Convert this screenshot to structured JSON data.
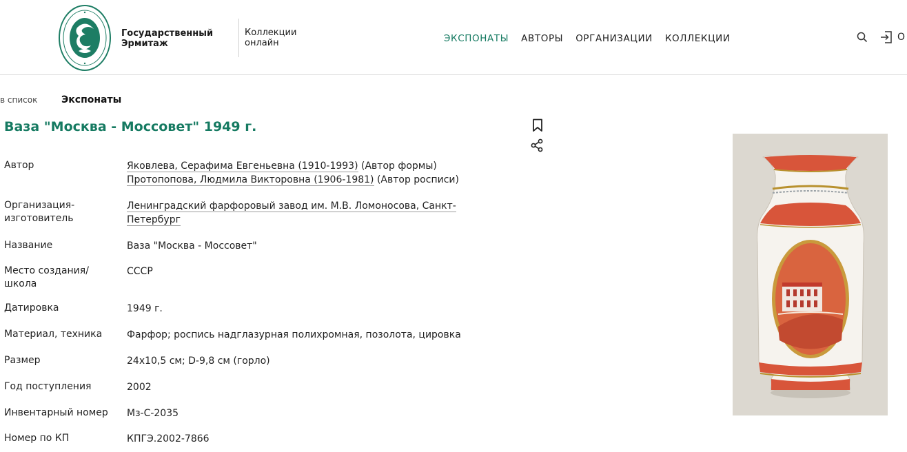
{
  "header": {
    "brand": "Государственный Эрмитаж",
    "section": "Коллекции онлайн",
    "nav": [
      "ЭКСПОНАТЫ",
      "АВТОРЫ",
      "ОРГАНИЗАЦИИ",
      "КОЛЛЕКЦИИ"
    ],
    "active_nav_index": 0,
    "trailing_text": "О",
    "icons": [
      "search-icon",
      "login-icon"
    ]
  },
  "breadcrumb": {
    "back": "в список",
    "current": "Экспонаты"
  },
  "item": {
    "title": "Ваза \"Москва - Моссовет\" 1949 г.",
    "image_alt": "Ваза \"Москва - Моссовет\"",
    "actions": [
      "bookmark-icon",
      "share-icon"
    ]
  },
  "details": {
    "author": {
      "label": "Автор",
      "entries": [
        {
          "name": "Яковлева, Серафима Евгеньевна (1910-1993)",
          "role": " (Автор формы)"
        },
        {
          "name": "Протопопова, Людмила Викторовна (1906-1981)",
          "role": " (Автор росписи)"
        }
      ]
    },
    "organization": {
      "label": "Организация-изготовитель",
      "value": "Ленинградский фарфоровый завод им. М.В. Ломоносова, Санкт-Петербург"
    },
    "name": {
      "label": "Название",
      "value": "Ваза \"Москва - Моссовет\""
    },
    "place": {
      "label": "Место создания/ школа",
      "value": "СССР"
    },
    "date": {
      "label": "Датировка",
      "value": "1949 г."
    },
    "material": {
      "label": "Материал, техника",
      "value": "Фарфор; роспись надглазурная полихромная, позолота, цировка"
    },
    "size": {
      "label": "Размер",
      "value": "24х10,5 см; D-9,8 см (горло)"
    },
    "acquired": {
      "label": "Год поступления",
      "value": "2002"
    },
    "inventory": {
      "label": "Инвентарный номер",
      "value": "Мз-С-2035"
    },
    "kp": {
      "label": "Номер по КП",
      "value": "КПГЭ.2002-7866"
    }
  },
  "colors": {
    "accent": "#157a61",
    "vase_orange": "#d8553a",
    "photo_bg": "#dcd8d0"
  }
}
